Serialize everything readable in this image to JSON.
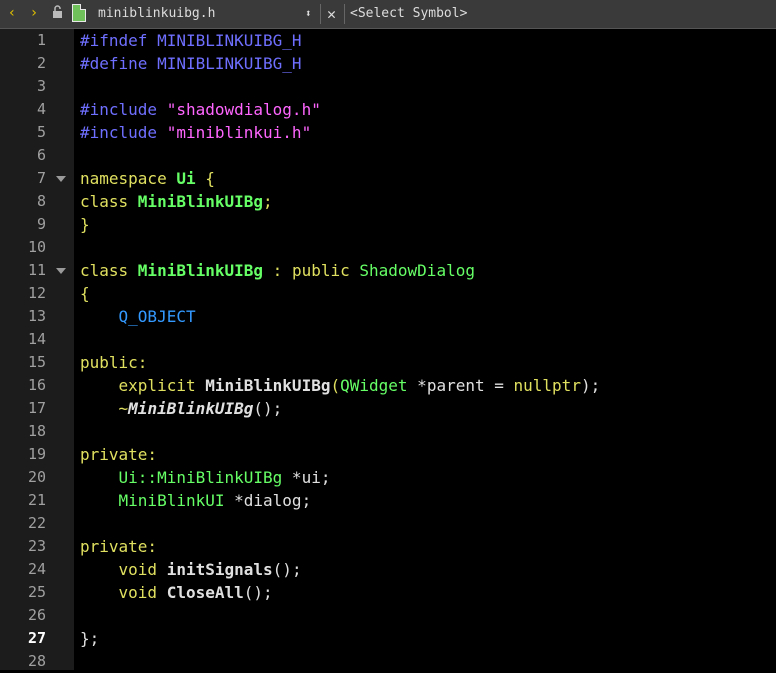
{
  "toolbar": {
    "back_icon": "‹",
    "forward_icon": "›",
    "filename": "miniblinkuibg.h",
    "updown_icon": "⬍",
    "close_icon": "✕",
    "symbol_label": "<Select Symbol>"
  },
  "gutter": {
    "current_line": 27,
    "line_numbers": [
      "1",
      "2",
      "3",
      "4",
      "5",
      "6",
      "7",
      "8",
      "9",
      "10",
      "11",
      "12",
      "13",
      "14",
      "15",
      "16",
      "17",
      "18",
      "19",
      "20",
      "21",
      "22",
      "23",
      "24",
      "25",
      "26",
      "27",
      "28"
    ],
    "fold_lines": [
      7,
      11
    ]
  },
  "code": {
    "l1_a": "#ifndef MINIBLINKUIBG_H",
    "l2_a": "#define MINIBLINKUIBG_H",
    "l4_a": "#include ",
    "l4_b": "\"shadowdialog.h\"",
    "l5_a": "#include ",
    "l5_b": "\"miniblinkui.h\"",
    "l7_a": "namespace ",
    "l7_b": "Ui",
    "l7_c": " {",
    "l8_a": "class ",
    "l8_b": "MiniBlinkUIBg",
    "l8_c": ";",
    "l9_a": "}",
    "l11_a": "class ",
    "l11_b": "MiniBlinkUIBg",
    "l11_c": " : ",
    "l11_d": "public ",
    "l11_e": "ShadowDialog",
    "l12_a": "{",
    "l13_a": "    Q_OBJECT",
    "l15_a": "public:",
    "l16_a": "    explicit ",
    "l16_b": "MiniBlinkUIBg",
    "l16_c": "(",
    "l16_d": "QWidget",
    "l16_e": " *parent = ",
    "l16_f": "nullptr",
    "l16_g": ");",
    "l17_a": "    ~",
    "l17_b": "MiniBlinkUIBg",
    "l17_c": "();",
    "l19_a": "private:",
    "l20_a": "    Ui::MiniBlinkUIBg",
    "l20_b": " *ui;",
    "l21_a": "    MiniBlinkUI",
    "l21_b": " *dialog;",
    "l23_a": "private:",
    "l24_a": "    void ",
    "l24_b": "initSignals",
    "l24_c": "();",
    "l25_a": "    void ",
    "l25_b": "CloseAll",
    "l25_c": "();",
    "l27_a": "};"
  }
}
